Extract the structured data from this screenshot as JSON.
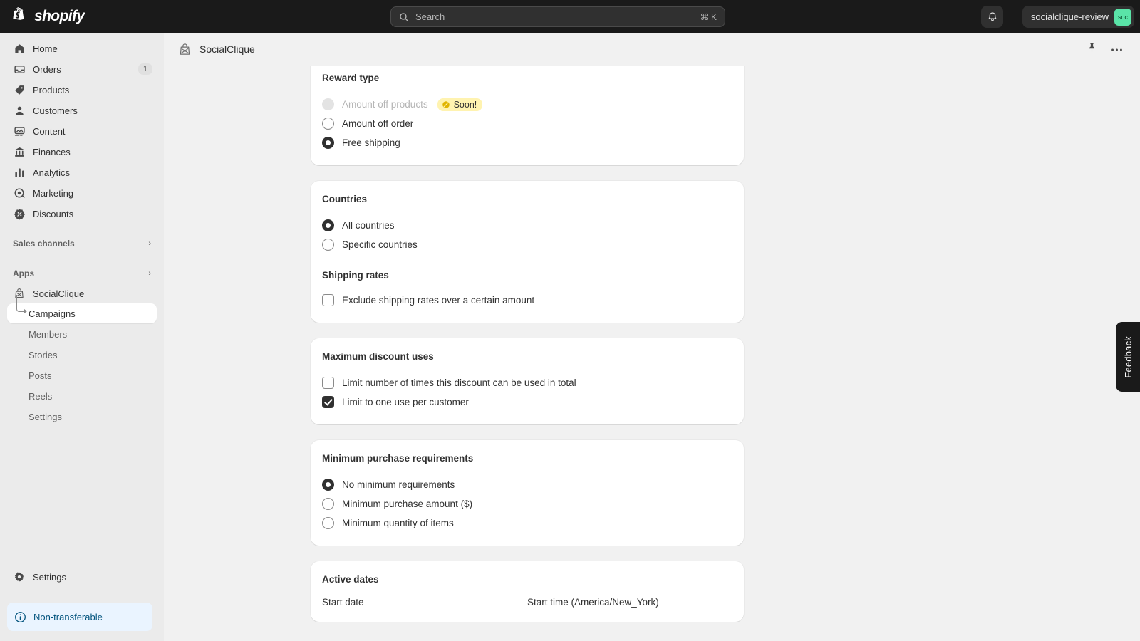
{
  "topbar": {
    "logo_text": "shopify",
    "search": {
      "placeholder": "Search",
      "shortcut": "⌘ K"
    },
    "store_name": "socialclique-review",
    "avatar_initials": "soc"
  },
  "sidebar": {
    "main_items": [
      {
        "label": "Home",
        "icon": "home-icon"
      },
      {
        "label": "Orders",
        "icon": "orders-icon",
        "badge": "1"
      },
      {
        "label": "Products",
        "icon": "products-icon"
      },
      {
        "label": "Customers",
        "icon": "customers-icon"
      },
      {
        "label": "Content",
        "icon": "content-icon"
      },
      {
        "label": "Finances",
        "icon": "finances-icon"
      },
      {
        "label": "Analytics",
        "icon": "analytics-icon"
      },
      {
        "label": "Marketing",
        "icon": "marketing-icon"
      },
      {
        "label": "Discounts",
        "icon": "discounts-icon"
      }
    ],
    "sales_channels_label": "Sales channels",
    "apps_label": "Apps",
    "app_name": "SocialClique",
    "app_subitems": [
      {
        "label": "Campaigns",
        "active": true
      },
      {
        "label": "Members",
        "active": false
      },
      {
        "label": "Stories",
        "active": false
      },
      {
        "label": "Posts",
        "active": false
      },
      {
        "label": "Reels",
        "active": false
      },
      {
        "label": "Settings",
        "active": false
      }
    ],
    "settings_label": "Settings",
    "info_banner_label": "Non-transferable"
  },
  "page_header": {
    "title": "SocialClique"
  },
  "cards": {
    "reward_type": {
      "title": "Reward type",
      "options": [
        {
          "label": "Amount off products",
          "state": "disabled",
          "badge": "Soon!"
        },
        {
          "label": "Amount off order",
          "state": "off"
        },
        {
          "label": "Free shipping",
          "state": "on"
        }
      ]
    },
    "countries": {
      "title": "Countries",
      "options": [
        {
          "label": "All countries",
          "state": "on"
        },
        {
          "label": "Specific countries",
          "state": "off"
        }
      ],
      "shipping_rates_title": "Shipping rates",
      "shipping_checkbox": {
        "label": "Exclude shipping rates over a certain amount",
        "state": "off"
      }
    },
    "maximum_discount_uses": {
      "title": "Maximum discount uses",
      "checkboxes": [
        {
          "label": "Limit number of times this discount can be used in total",
          "state": "off"
        },
        {
          "label": "Limit to one use per customer",
          "state": "on"
        }
      ]
    },
    "minimum_purchase": {
      "title": "Minimum purchase requirements",
      "options": [
        {
          "label": "No minimum requirements",
          "state": "on"
        },
        {
          "label": "Minimum purchase amount ($)",
          "state": "off"
        },
        {
          "label": "Minimum quantity of items",
          "state": "off"
        }
      ]
    },
    "active_dates": {
      "title": "Active dates",
      "start_date_label": "Start date",
      "start_time_label": "Start time (America/New_York)"
    }
  },
  "feedback_tab": {
    "label": "Feedback"
  },
  "colors": {
    "topbar_bg": "#1a1a1a",
    "sidebar_bg": "#ebebeb",
    "page_bg": "#f1f1f1",
    "card_bg": "#ffffff",
    "accent_green": "#5ae4a8",
    "badge_yellow": "#fff3b0",
    "info_blue": "#eaf4ff",
    "info_blue_text": "#00527c"
  }
}
